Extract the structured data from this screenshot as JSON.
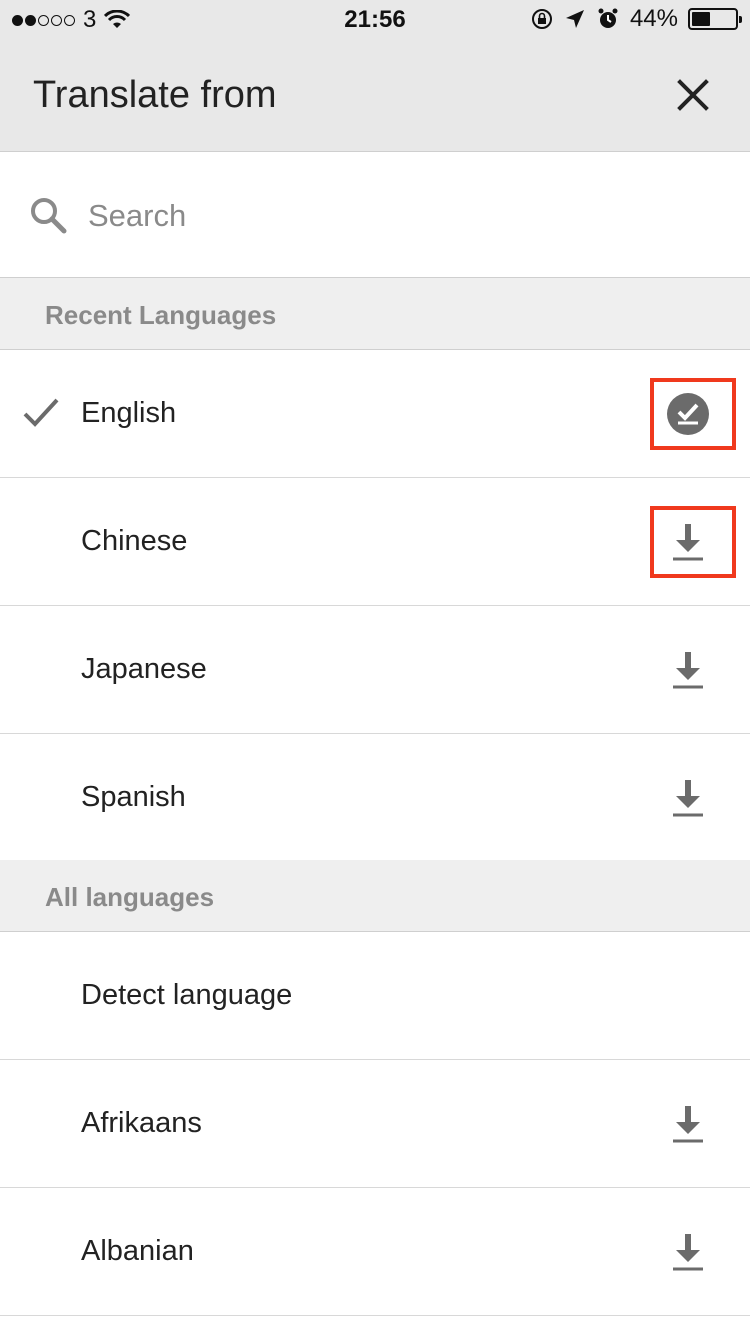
{
  "status_bar": {
    "carrier": "3",
    "time": "21:56",
    "battery": "44%",
    "signal_dots_filled": 2,
    "signal_dots_total": 5,
    "battery_level": 0.44
  },
  "header": {
    "title": "Translate from",
    "close_icon": "close-icon"
  },
  "search": {
    "placeholder": "Search",
    "icon": "search-icon"
  },
  "sections": {
    "recent": "Recent Languages",
    "all": "All languages"
  },
  "recent_languages": [
    {
      "name": "English",
      "selected": true,
      "status": "downloaded",
      "icon": "downloaded-check-icon",
      "highlighted": true
    },
    {
      "name": "Chinese",
      "selected": false,
      "status": "download",
      "icon": "download-icon",
      "highlighted": true
    },
    {
      "name": "Japanese",
      "selected": false,
      "status": "download",
      "icon": "download-icon",
      "highlighted": false
    },
    {
      "name": "Spanish",
      "selected": false,
      "status": "download",
      "icon": "download-icon",
      "highlighted": false
    }
  ],
  "all_languages": [
    {
      "name": "Detect language",
      "status": "none"
    },
    {
      "name": "Afrikaans",
      "status": "download",
      "icon": "download-icon"
    },
    {
      "name": "Albanian",
      "status": "download",
      "icon": "download-icon"
    }
  ],
  "colors": {
    "header_bg": "#e8e8e8",
    "section_bg": "#efefef",
    "icon_gray": "#6b6b6b",
    "highlight_red": "#f0391d"
  }
}
